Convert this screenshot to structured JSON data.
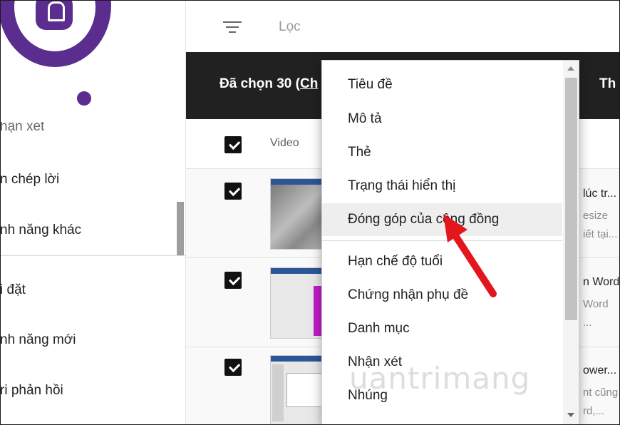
{
  "sidebar": {
    "items": [
      {
        "label": "hận xét"
      },
      {
        "label": "n chép lời"
      },
      {
        "label": "nh năng khác"
      },
      {
        "label": "i đặt"
      },
      {
        "label": "nh năng mới"
      },
      {
        "label": "ri phản hồi"
      }
    ]
  },
  "filter": {
    "placeholder": "Lọc"
  },
  "selection": {
    "prefix": "Đã chọn 30 (",
    "link": "Ch",
    "right_label": "Th"
  },
  "table": {
    "header_video": "Video"
  },
  "rows": [
    {
      "title": "lúc tr...",
      "desc_line1": "esize",
      "desc_line2": "iết tại..."
    },
    {
      "title": "n Word",
      "desc_line1": "Word",
      "desc_line2": "..."
    },
    {
      "title": "ower...",
      "desc_line1": "nt cũng",
      "desc_line2": "rd,..."
    }
  ],
  "dropdown": {
    "items": [
      {
        "label": "Tiêu đề"
      },
      {
        "label": "Mô tả"
      },
      {
        "label": "Thẻ"
      },
      {
        "label": "Trạng thái hiển thị"
      },
      {
        "label": "Đóng góp của cộng đồng"
      },
      {
        "label": "Hạn chế độ tuổi"
      },
      {
        "label": "Chứng nhận phụ đề"
      },
      {
        "label": "Danh mục"
      },
      {
        "label": "Nhận xét"
      },
      {
        "label": "Nhúng"
      }
    ],
    "hovered_index": 4
  },
  "watermark": "uantrimang",
  "colors": {
    "brand": "#5b2d8e",
    "selection_bar": "#212121",
    "annotation": "#e3161e"
  },
  "icons": {
    "filter": "filter-icon",
    "annotation": "red-arrow-icon"
  }
}
